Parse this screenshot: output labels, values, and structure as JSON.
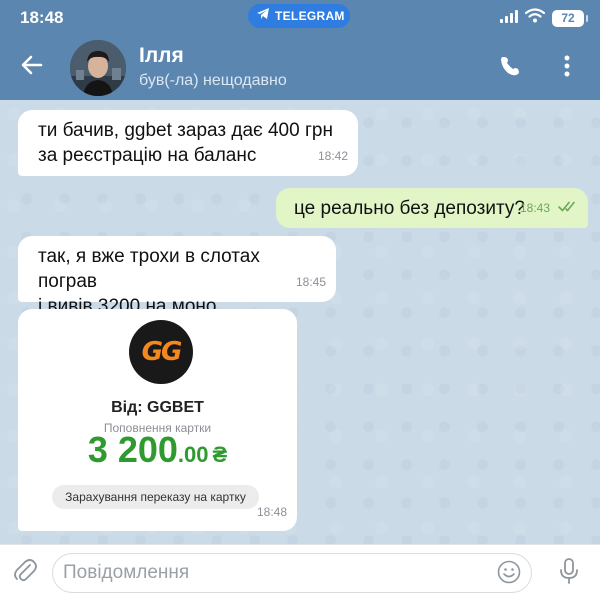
{
  "status_bar": {
    "time": "18:48",
    "telegram_label": "TELEGRAM",
    "battery": "72",
    "icons": [
      "telegram-icon",
      "signal-icon",
      "wifi-icon",
      "battery-icon"
    ]
  },
  "header": {
    "contact_name": "Ілля",
    "contact_status": "був(-ла) нещодавно",
    "icons": [
      "back-arrow-icon",
      "phone-icon",
      "more-vertical-icon"
    ],
    "bar_color": "#5b86b0"
  },
  "messages": [
    {
      "direction": "in",
      "lines": [
        "ти бачив, ggbet зараз дає 400 грн",
        "за реєстрацію на баланс"
      ],
      "time": "18:42"
    },
    {
      "direction": "out",
      "lines": [
        "це реально без депозиту?"
      ],
      "time": "18:43",
      "read": true
    },
    {
      "direction": "in",
      "lines": [
        "так, я вже трохи в слотах пограв",
        "і вивів 3200 на моно"
      ],
      "time": "18:45"
    }
  ],
  "receipt": {
    "logo_text": "GG",
    "from": "Від: GGBET",
    "subtitle": "Поповнення картки",
    "amount_int": "3 200",
    "amount_dec": ".00",
    "currency": "₴",
    "note": "Зарахування переказу на картку",
    "time": "18:48",
    "accent_color": "#2f9a2f",
    "logo_color": "#f5871f"
  },
  "input_bar": {
    "placeholder": "Повідомлення",
    "value": "",
    "icons": [
      "paperclip-icon",
      "emoji-icon",
      "microphone-icon"
    ]
  }
}
